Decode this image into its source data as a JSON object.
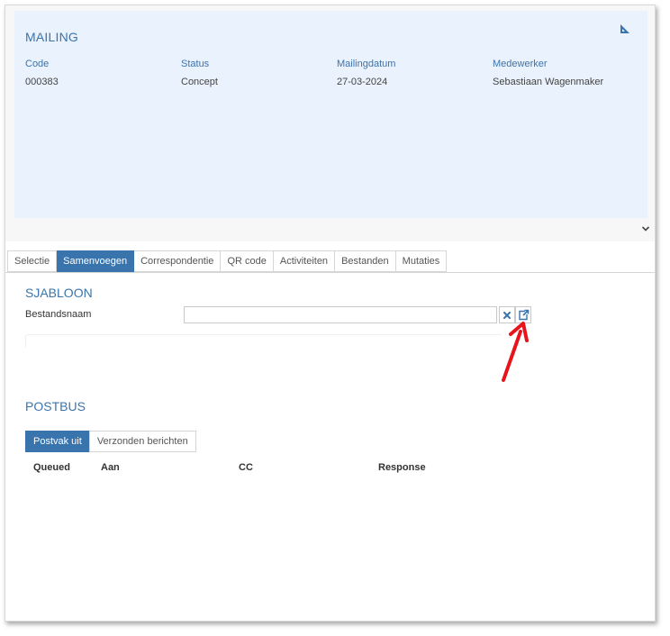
{
  "mailing": {
    "title": "MAILING",
    "fields": [
      {
        "label": "Code",
        "value": "000383"
      },
      {
        "label": "Status",
        "value": "Concept"
      },
      {
        "label": "Mailingdatum",
        "value": "27-03-2024"
      },
      {
        "label": "Medewerker",
        "value": "Sebastiaan Wagenmaker"
      }
    ]
  },
  "tabs": [
    {
      "label": "Selectie",
      "active": false
    },
    {
      "label": "Samenvoegen",
      "active": true
    },
    {
      "label": "Correspondentie",
      "active": false
    },
    {
      "label": "QR code",
      "active": false
    },
    {
      "label": "Activiteiten",
      "active": false
    },
    {
      "label": "Bestanden",
      "active": false
    },
    {
      "label": "Mutaties",
      "active": false
    }
  ],
  "sjabloon": {
    "title": "SJABLOON",
    "bestandsnaam_label": "Bestandsnaam",
    "bestandsnaam_value": ""
  },
  "postbus": {
    "title": "POSTBUS",
    "tabs": [
      {
        "label": "Postvak uit",
        "active": true
      },
      {
        "label": "Verzonden berichten",
        "active": false
      }
    ],
    "columns": [
      "Queued",
      "Aan",
      "CC",
      "Response"
    ]
  },
  "colors": {
    "accent": "#3a74ad",
    "panel_bg": "#eaf2fd",
    "annotation_arrow": "#e8141c"
  },
  "icons": [
    "ruler-triangle-icon",
    "chevron-down-icon",
    "clear-icon",
    "open-external-icon",
    "annotation-arrow"
  ]
}
